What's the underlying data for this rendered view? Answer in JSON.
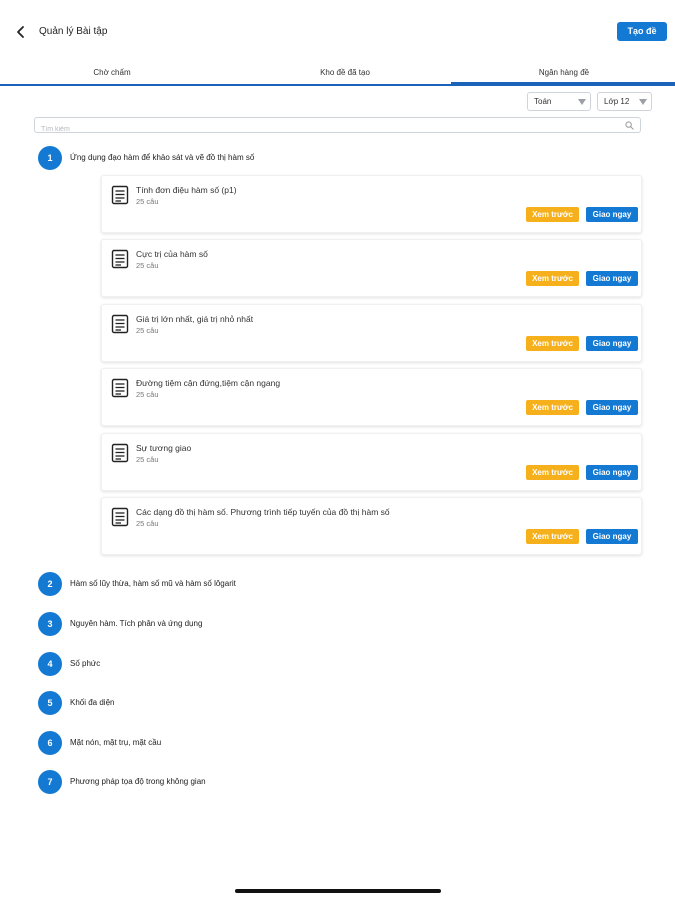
{
  "header": {
    "title": "Quản lý Bài tập",
    "create_label": "Tạo đề"
  },
  "tabs": [
    {
      "label": "Chờ chấm"
    },
    {
      "label": "Kho đề đã tạo"
    },
    {
      "label": "Ngân hàng đề"
    }
  ],
  "active_tab": 2,
  "filters": {
    "subject": "Toán",
    "grade": "Lớp 12"
  },
  "search": {
    "placeholder": "Tìm kiếm"
  },
  "topics": [
    {
      "num": "1",
      "title": "Ứng dụng đạo hàm để khảo sát và vẽ đồ thị hàm số"
    },
    {
      "num": "2",
      "title": "Hàm số lũy thừa, hàm số mũ và hàm số lôgarit"
    },
    {
      "num": "3",
      "title": "Nguyên hàm. Tích phân và ứng dụng"
    },
    {
      "num": "4",
      "title": "Số phức"
    },
    {
      "num": "5",
      "title": "Khối đa diện"
    },
    {
      "num": "6",
      "title": "Mặt nón, mặt trụ, mặt cầu"
    },
    {
      "num": "7",
      "title": "Phương pháp tọa độ trong không gian"
    }
  ],
  "lessons": [
    {
      "title": "Tính đơn điệu hàm số (p1)",
      "count": "25 câu"
    },
    {
      "title": "Cực trị của hàm số",
      "count": "25 câu"
    },
    {
      "title": "Giá trị lớn nhất, giá trị nhỏ nhất",
      "count": "25 câu"
    },
    {
      "title": "Đường tiệm cận đứng,tiệm cận ngang",
      "count": "25 câu"
    },
    {
      "title": "Sự tương giao",
      "count": "25 câu"
    },
    {
      "title": "Các dạng đồ thị hàm số. Phương trình tiếp tuyến của đồ thị hàm số",
      "count": "25 câu"
    }
  ],
  "actions": {
    "preview_label": "Xem trước",
    "assign_label": "Giao ngay"
  },
  "colors": {
    "accent": "#1379d3",
    "preview": "#f5b01b",
    "tab_underline": "#1b63b8"
  }
}
